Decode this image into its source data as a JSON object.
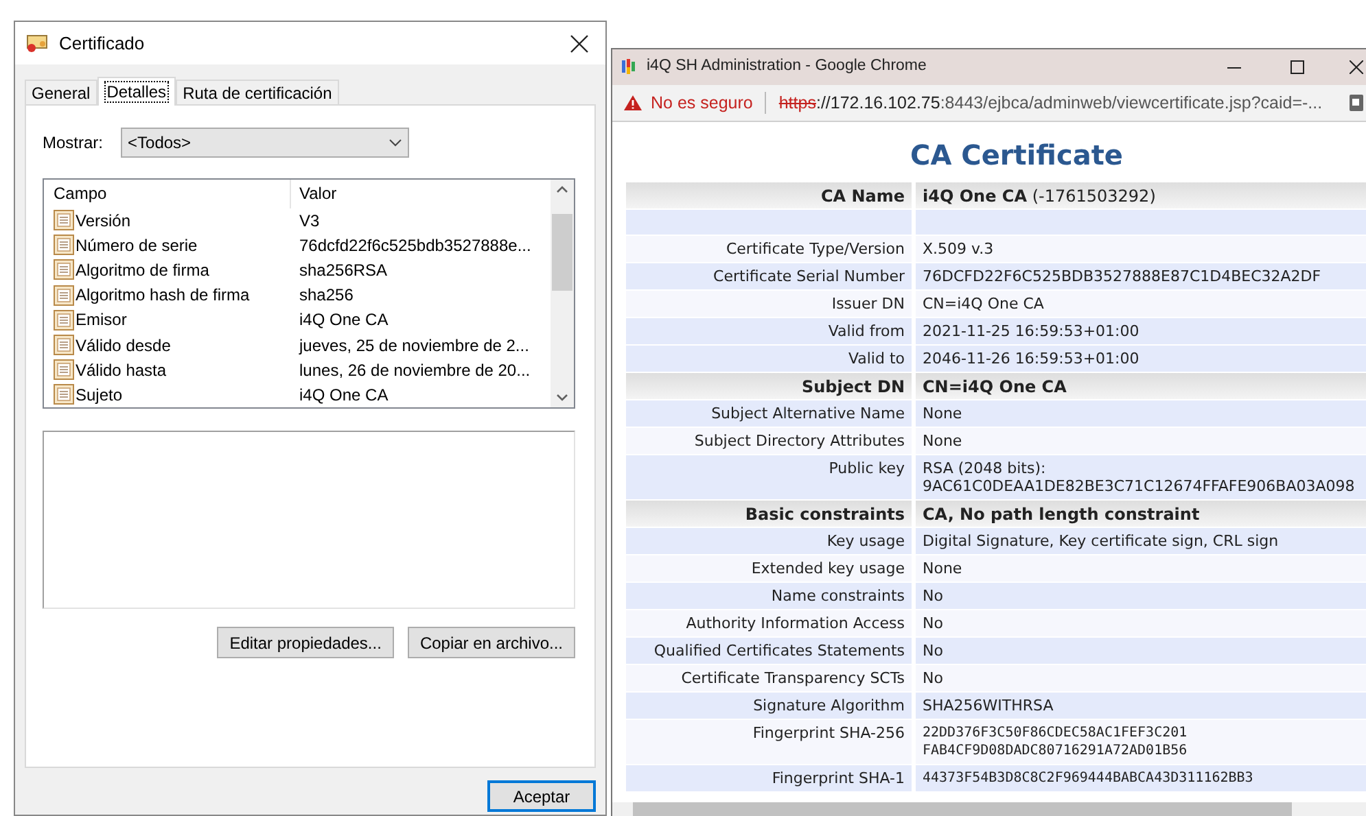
{
  "dialog": {
    "title": "Certificado",
    "tabs": [
      {
        "label": "General",
        "selected": false
      },
      {
        "label": "Detalles",
        "selected": true
      },
      {
        "label": "Ruta de certificación",
        "selected": false
      }
    ],
    "show_label": "Mostrar:",
    "show_select": {
      "value": "<Todos>"
    },
    "columns": [
      "Campo",
      "Valor"
    ],
    "fields": [
      {
        "field": "Versión",
        "value": "V3"
      },
      {
        "field": "Número de serie",
        "value": "76dcfd22f6c525bdb3527888e..."
      },
      {
        "field": "Algoritmo de firma",
        "value": "sha256RSA"
      },
      {
        "field": "Algoritmo hash de firma",
        "value": "sha256"
      },
      {
        "field": "Emisor",
        "value": "i4Q One CA"
      },
      {
        "field": "Válido desde",
        "value": "jueves, 25 de noviembre de 2..."
      },
      {
        "field": "Válido hasta",
        "value": "lunes, 26 de noviembre de 20..."
      },
      {
        "field": "Sujeto",
        "value": "i4Q One CA"
      }
    ],
    "buttons": [
      "Editar propiedades...",
      "Copiar en archivo..."
    ],
    "ok_button": "Aceptar"
  },
  "browser": {
    "title": "i4Q SH Administration - Google Chrome",
    "security": "No es seguro",
    "url": {
      "scheme": "https",
      "host": "://172.16.102.75",
      "rest": ":8443/ejbca/adminweb/viewcertificate.jsp?caid=-..."
    },
    "heading": "CA Certificate",
    "rows": [
      {
        "kind": "header",
        "label": "CA Name",
        "value": "i4Q One CA",
        "note": "(-1761503292)"
      },
      {
        "kind": "blank",
        "shaded": true
      },
      {
        "kind": "row",
        "label": "Certificate Type/Version",
        "lines": [
          "X.509 v.3"
        ],
        "shaded": false
      },
      {
        "kind": "row",
        "label": "Certificate Serial Number",
        "lines": [
          "76DCFD22F6C525BDB3527888E87C1D4BEC32A2DF"
        ],
        "shaded": true
      },
      {
        "kind": "row",
        "label": "Issuer DN",
        "lines": [
          "CN=i4Q One CA"
        ],
        "shaded": false
      },
      {
        "kind": "row",
        "label": "Valid from",
        "lines": [
          "2021-11-25 16:59:53+01:00"
        ],
        "shaded": true
      },
      {
        "kind": "row",
        "label": "Valid to",
        "lines": [
          "2046-11-26 16:59:53+01:00"
        ],
        "shaded": true
      },
      {
        "kind": "header",
        "label": "Subject DN",
        "value": "CN=i4Q One CA"
      },
      {
        "kind": "row",
        "label": "Subject Alternative Name",
        "lines": [
          "None"
        ],
        "shaded": true
      },
      {
        "kind": "row",
        "label": "Subject Directory Attributes",
        "lines": [
          "None"
        ],
        "shaded": false
      },
      {
        "kind": "row",
        "label": "Public key",
        "lines": [
          "RSA (2048 bits):",
          "9AC61C0DEAA1DE82BE3C71C12674FFAFE906BA03A098"
        ],
        "shaded": true
      },
      {
        "kind": "header",
        "label": "Basic constraints",
        "value": "CA, No path length constraint"
      },
      {
        "kind": "row",
        "label": "Key usage",
        "lines": [
          "Digital Signature, Key certificate sign, CRL sign"
        ],
        "shaded": true
      },
      {
        "kind": "row",
        "label": "Extended key usage",
        "lines": [
          "None"
        ],
        "shaded": false
      },
      {
        "kind": "row",
        "label": "Name constraints",
        "lines": [
          "No"
        ],
        "shaded": true
      },
      {
        "kind": "row",
        "label": "Authority Information Access",
        "lines": [
          "No"
        ],
        "shaded": false
      },
      {
        "kind": "row",
        "label": "Qualified Certificates Statements",
        "lines": [
          "No"
        ],
        "shaded": true
      },
      {
        "kind": "row",
        "label": "Certificate Transparency SCTs",
        "lines": [
          "No"
        ],
        "shaded": false
      },
      {
        "kind": "row",
        "label": "Signature Algorithm",
        "lines": [
          "SHA256WITHRSA"
        ],
        "shaded": true
      },
      {
        "kind": "fingerprint",
        "label": "Fingerprint SHA-256",
        "lines": [
          "22DD376F3C50F86CDEC58AC1FEF3C201",
          "FAB4CF9D08DADC80716291A72AD01B56"
        ],
        "shaded": false
      },
      {
        "kind": "fingerprint",
        "label": "Fingerprint SHA-1",
        "lines": [
          "44373F54B3D8C8C2F969444BABCA43D311162BB3"
        ],
        "shaded": true
      }
    ]
  }
}
